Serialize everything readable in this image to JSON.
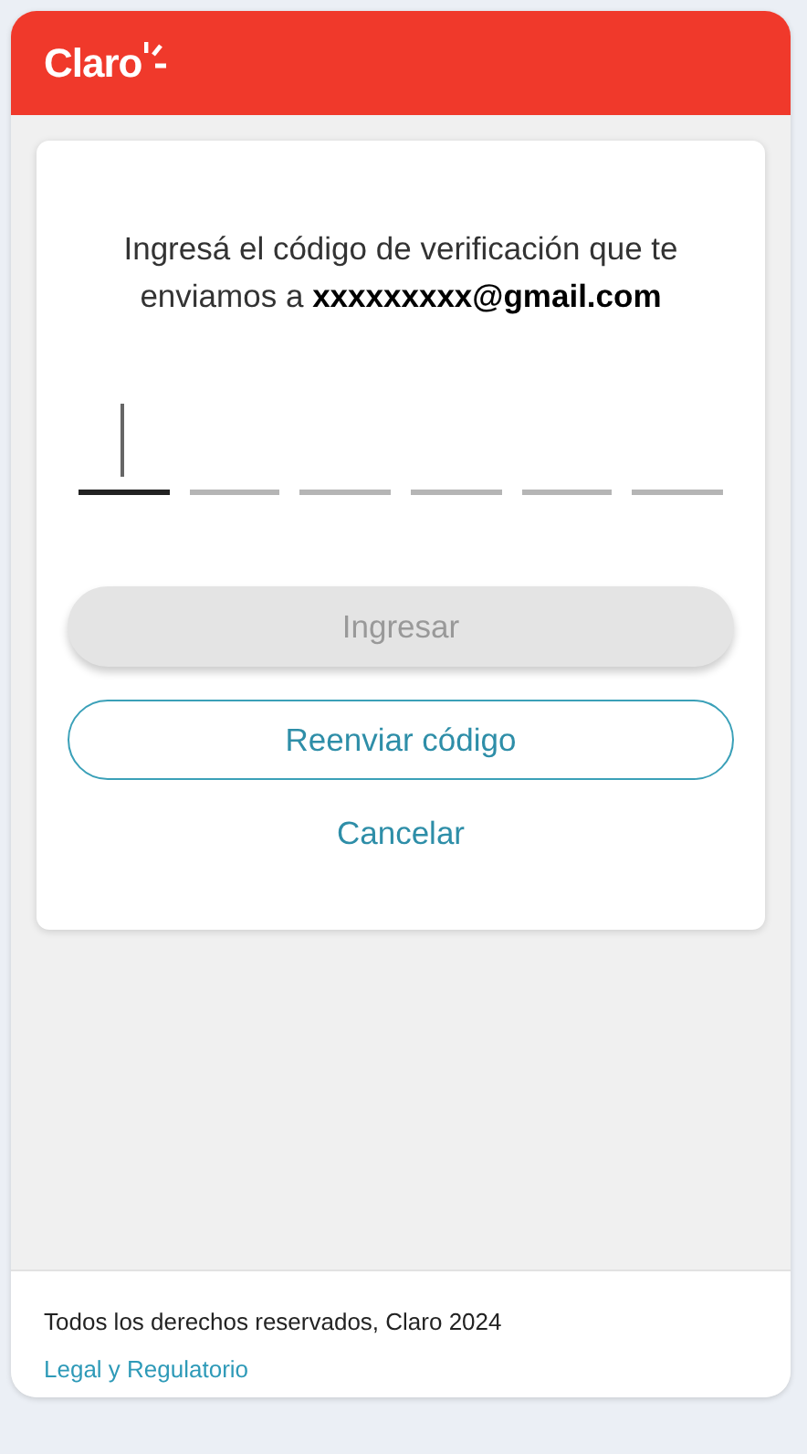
{
  "header": {
    "brand": "Claro"
  },
  "message": "Ingresá el código de verificación que te enviamos a  **xxxxxxxxx@gmail.com**",
  "code_boxes": [
    {
      "selected": true
    },
    {
      "selected": false
    },
    {
      "selected": false
    },
    {
      "selected": false
    },
    {
      "selected": false
    },
    {
      "selected": false
    }
  ],
  "buttons": [
    {
      "kind": "primary",
      "label": "Ingresar",
      "disabled": true
    },
    {
      "kind": "outline",
      "label": "Reenviar código",
      "disabled": false
    },
    {
      "kind": "link",
      "label": "Cancelar",
      "disabled": false
    }
  ],
  "footer": {
    "copyright": "Todos los derechos reservados, Claro 2024",
    "link": "Legal y Regulatorio"
  }
}
